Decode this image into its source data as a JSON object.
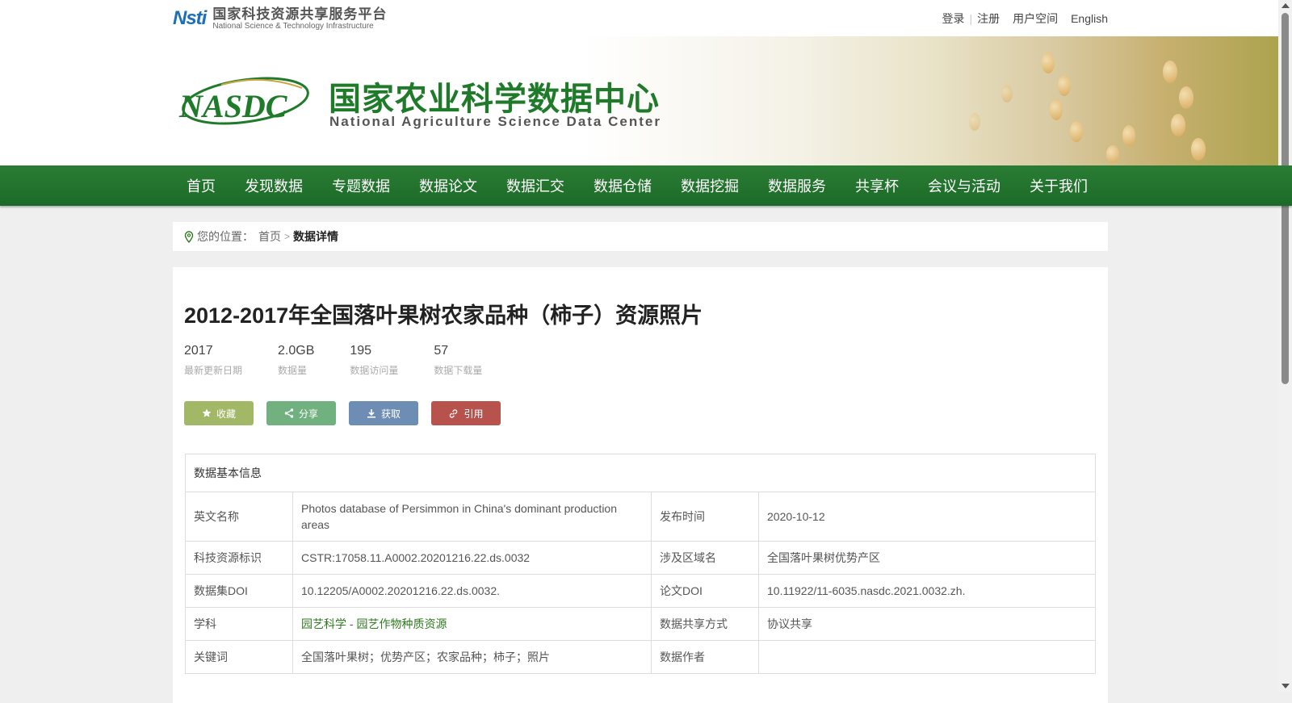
{
  "platform": {
    "logo_mark": "Nsti",
    "name_cn": "国家科技资源共享服务平台",
    "name_en": "National Science & Technology Infrastructure"
  },
  "top_links": {
    "login": "登录",
    "register": "注册",
    "user_space": "用户空间",
    "english": "English"
  },
  "center": {
    "logo_text": "NASDC",
    "name_cn": "国家农业科学数据中心",
    "name_en": "National Agriculture Science Data Center"
  },
  "nav": [
    "首页",
    "发现数据",
    "专题数据",
    "数据论文",
    "数据汇交",
    "数据仓储",
    "数据挖掘",
    "数据服务",
    "共享杯",
    "会议与活动",
    "关于我们"
  ],
  "breadcrumb": {
    "prefix": "您的位置：",
    "home": "首页",
    "current": "数据详情"
  },
  "dataset": {
    "title": "2012-2017年全国落叶果树农家品种（柿子）资源照片",
    "stats": [
      {
        "value": "2017",
        "label": "最新更新日期"
      },
      {
        "value": "2.0GB",
        "label": "数据量"
      },
      {
        "value": "195",
        "label": "数据访问量"
      },
      {
        "value": "57",
        "label": "数据下载量"
      }
    ],
    "actions": {
      "favorite": "收藏",
      "share": "分享",
      "get": "获取",
      "cite": "引用"
    }
  },
  "info_table": {
    "header": "数据基本信息",
    "rows": [
      {
        "k1": "英文名称",
        "v1": "Photos database of Persimmon in China's dominant production areas",
        "k2": "发布时间",
        "v2": "2020-10-12"
      },
      {
        "k1": "科技资源标识",
        "v1": "CSTR:17058.11.A0002.20201216.22.ds.0032",
        "k2": "涉及区域名",
        "v2": "全国落叶果树优势产区"
      },
      {
        "k1": "数据集DOI",
        "v1": "10.12205/A0002.20201216.22.ds.0032.",
        "k2": "论文DOI",
        "v2": "10.11922/11-6035.nasdc.2021.0032.zh."
      },
      {
        "k1": "学科",
        "v1_link1": "园艺科学",
        "v1_sep": " - ",
        "v1_link2": "园艺作物种质资源",
        "k2": "数据共享方式",
        "v2": "协议共享"
      },
      {
        "k1": "关键词",
        "v1": "全国落叶果树；优势产区；农家品种；柿子；照片",
        "k2": "数据作者",
        "v2": ""
      }
    ]
  },
  "colors": {
    "nav_green": "#1f722c",
    "brand_green": "#1f7a2a",
    "favorite_btn": "#a3b866",
    "share_btn": "#71b17f",
    "get_btn": "#6d8db4",
    "cite_btn": "#b8524d"
  }
}
